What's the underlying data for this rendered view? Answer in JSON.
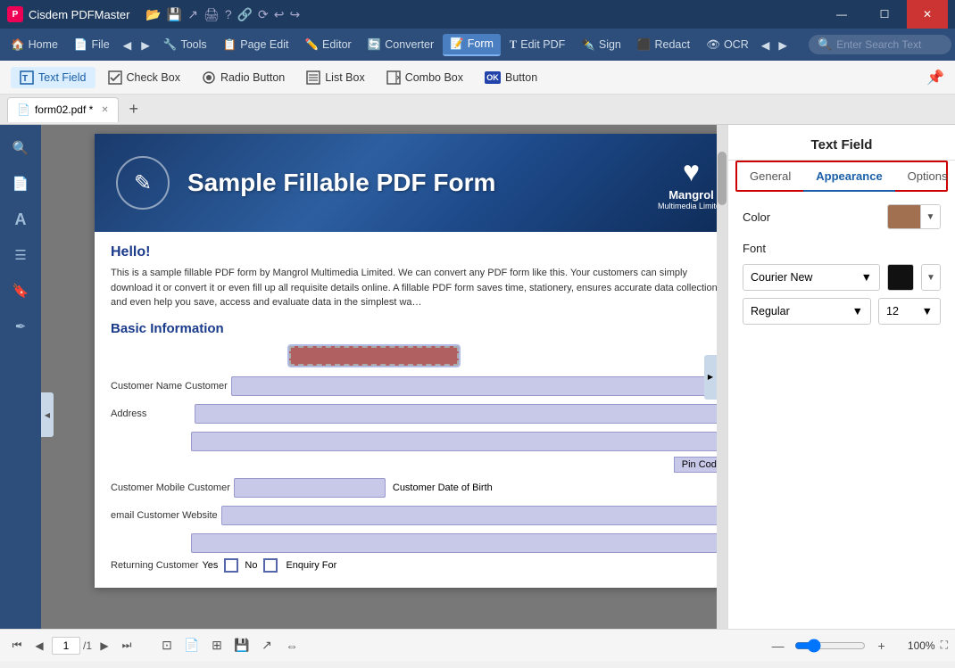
{
  "app": {
    "title": "Cisdem PDFMaster",
    "tab_label": "form02.pdf *"
  },
  "titlebar": {
    "title": "Cisdem PDFMaster",
    "controls": [
      "—",
      "☐",
      "✕"
    ]
  },
  "menubar": {
    "items": [
      {
        "id": "home",
        "label": "Home",
        "icon": "🏠",
        "active": false
      },
      {
        "id": "file",
        "label": "File",
        "icon": "📄",
        "active": false
      },
      {
        "id": "back",
        "label": "◀",
        "icon": "",
        "active": false
      },
      {
        "id": "tools",
        "label": "Tools",
        "icon": "🔧",
        "active": false
      },
      {
        "id": "page-edit",
        "label": "Page Edit",
        "icon": "📋",
        "active": false
      },
      {
        "id": "editor",
        "label": "Editor",
        "icon": "✏️",
        "active": false
      },
      {
        "id": "converter",
        "label": "Converter",
        "icon": "🔄",
        "active": false
      },
      {
        "id": "form",
        "label": "Form",
        "icon": "📝",
        "active": true
      },
      {
        "id": "edit-pdf",
        "label": "Edit PDF",
        "icon": "T",
        "active": false
      },
      {
        "id": "sign",
        "label": "Sign",
        "icon": "✒️",
        "active": false
      },
      {
        "id": "redact",
        "label": "Redact",
        "icon": "⬛",
        "active": false
      },
      {
        "id": "ocr",
        "label": "OCR",
        "icon": "👁",
        "active": false
      }
    ],
    "search_placeholder": "Enter Search Text"
  },
  "toolbar": {
    "buttons": [
      {
        "id": "text-field",
        "label": "Text Field",
        "icon": "T",
        "active": true
      },
      {
        "id": "check-box",
        "label": "Check Box",
        "icon": "☑",
        "active": false
      },
      {
        "id": "radio-button",
        "label": "Radio Button",
        "icon": "◉",
        "active": false
      },
      {
        "id": "list-box",
        "label": "List Box",
        "icon": "☰",
        "active": false
      },
      {
        "id": "combo-box",
        "label": "Combo Box",
        "icon": "⊞",
        "active": false
      },
      {
        "id": "button",
        "label": "Button",
        "icon": "OK",
        "active": false
      }
    ],
    "pin_label": "📌"
  },
  "pdf": {
    "header_title": "Sample Fillable PDF Form",
    "header_logo_name": "Mangrol",
    "header_logo_sub": "Multimedia Limited",
    "hello_text": "Hello!",
    "description": "This is a sample fillable PDF form by Mangrol Multimedia Limited. We can convert any PDF form like this. Your customers can simply download it or convert it or even fill up all requisite details online. A fillable PDF form saves time, stationery, ensures accurate data collection and even help you save, access and evaluate data in the simplest wa…",
    "section_title": "Basic Information",
    "pin_code_label": "Pin Code",
    "customer_date_label": "Customer Date of Birth",
    "returning_customer_label": "Returning Customer",
    "yes_label": "Yes",
    "no_label": "No",
    "enquiry_label": "Enquiry For",
    "customer_name_label": "Customer Name Customer",
    "address_label": "Address",
    "customer_mobile_label": "Customer Mobile  Customer",
    "customer_email_label": "email Customer Website"
  },
  "right_panel": {
    "title": "Text Field",
    "tabs": [
      {
        "id": "general",
        "label": "General",
        "active": false
      },
      {
        "id": "appearance",
        "label": "Appearance",
        "active": true
      },
      {
        "id": "options",
        "label": "Options",
        "active": false
      }
    ],
    "color_label": "Color",
    "color_value": "#a07050",
    "font_label": "Font",
    "font_name": "Courier New",
    "font_color": "#111111",
    "font_style": "Regular",
    "font_size": "12"
  },
  "bottombar": {
    "page_current": "1",
    "page_total": "/1",
    "zoom_level": "100%"
  }
}
